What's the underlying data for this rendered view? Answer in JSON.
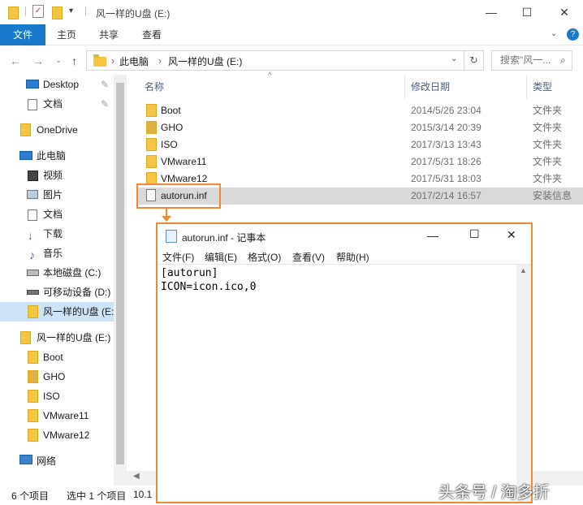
{
  "window": {
    "title": "风一样的U盘 (E:)",
    "minimize": "—",
    "maximize": "☐",
    "close": "✕",
    "help": "?"
  },
  "ribbon": {
    "tabs": [
      "文件",
      "主页",
      "共享",
      "查看"
    ]
  },
  "address": {
    "segments": [
      "此电脑",
      "风一样的U盘 (E:)"
    ],
    "search_placeholder": "搜索\"风一..."
  },
  "sidebar": {
    "items": [
      {
        "label": "Desktop",
        "icon": "desktop-icon",
        "pinned": true
      },
      {
        "label": "文档",
        "icon": "document-icon",
        "pinned": true
      },
      {
        "label": "OneDrive",
        "icon": "folder-icon"
      },
      {
        "label": "此电脑",
        "icon": "computer-icon"
      },
      {
        "label": "视频",
        "icon": "video-icon"
      },
      {
        "label": "图片",
        "icon": "picture-icon"
      },
      {
        "label": "文档",
        "icon": "document-icon"
      },
      {
        "label": "下载",
        "icon": "download-icon"
      },
      {
        "label": "音乐",
        "icon": "music-icon"
      },
      {
        "label": "本地磁盘 (C:)",
        "icon": "drive-icon"
      },
      {
        "label": "可移动设备 (D:)",
        "icon": "removable-drive-icon"
      },
      {
        "label": "风一样的U盘 (E:",
        "icon": "folder-icon",
        "selected": true
      },
      {
        "label": "风一样的U盘 (E:)",
        "icon": "folder-icon"
      },
      {
        "label": "Boot",
        "icon": "folder-icon"
      },
      {
        "label": "GHO",
        "icon": "folder-icon"
      },
      {
        "label": "ISO",
        "icon": "folder-icon"
      },
      {
        "label": "VMware11",
        "icon": "folder-icon"
      },
      {
        "label": "VMware12",
        "icon": "folder-icon"
      },
      {
        "label": "网络",
        "icon": "network-icon"
      }
    ]
  },
  "columns": {
    "name": "名称",
    "date": "修改日期",
    "type": "类型"
  },
  "files": [
    {
      "name": "Boot",
      "date": "2014/5/26 23:04",
      "type": "文件夹",
      "icon": "folder-icon"
    },
    {
      "name": "GHO",
      "date": "2015/3/14 20:39",
      "type": "文件夹",
      "icon": "folder-icon"
    },
    {
      "name": "ISO",
      "date": "2017/3/13 13:43",
      "type": "文件夹",
      "icon": "folder-icon"
    },
    {
      "name": "VMware11",
      "date": "2017/5/31 18:26",
      "type": "文件夹",
      "icon": "folder-icon"
    },
    {
      "name": "VMware12",
      "date": "2017/5/31 18:03",
      "type": "文件夹",
      "icon": "folder-icon"
    },
    {
      "name": "autorun.inf",
      "date": "2017/2/14 16:57",
      "type": "安装信息",
      "icon": "inf-file-icon",
      "selected": true
    }
  ],
  "status": {
    "count": "6 个项目",
    "selected": "选中 1 个项目",
    "size": "10.1"
  },
  "notepad": {
    "title": "autorun.inf - 记事本",
    "menu": [
      "文件(F)",
      "编辑(E)",
      "格式(O)",
      "查看(V)",
      "帮助(H)"
    ],
    "content": "[autorun]\nICON=icon.ico,0"
  },
  "watermark": "头条号 / 淘多折"
}
